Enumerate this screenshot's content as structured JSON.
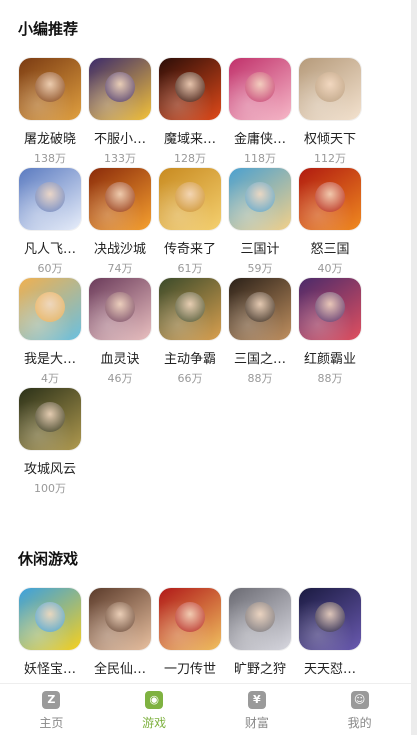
{
  "sections": [
    {
      "title": "小编推荐",
      "games": [
        {
          "name": "屠龙破晓",
          "count": "138万",
          "colors": [
            "#7a3a12",
            "#e0a040"
          ]
        },
        {
          "name": "不服小…",
          "count": "133万",
          "colors": [
            "#3b2a6b",
            "#f3c23b"
          ]
        },
        {
          "name": "魔域来…",
          "count": "128万",
          "colors": [
            "#2a0d08",
            "#e04a1a"
          ]
        },
        {
          "name": "金庸侠…",
          "count": "118万",
          "colors": [
            "#c0306a",
            "#f6b8c8"
          ]
        },
        {
          "name": "权倾天下",
          "count": "112万",
          "colors": [
            "#b59a7a",
            "#f3e2cf"
          ]
        },
        {
          "name": "凡人飞…",
          "count": "60万",
          "colors": [
            "#5a7ac0",
            "#e8eefa"
          ]
        },
        {
          "name": "决战沙城",
          "count": "74万",
          "colors": [
            "#8a2a0a",
            "#f5a030"
          ]
        },
        {
          "name": "传奇来了",
          "count": "61万",
          "colors": [
            "#c88a20",
            "#f4d070"
          ]
        },
        {
          "name": "三国计",
          "count": "59万",
          "colors": [
            "#4aa0d0",
            "#f2d08a"
          ]
        },
        {
          "name": "怒三国",
          "count": "40万",
          "colors": [
            "#b01a10",
            "#f08a20"
          ]
        },
        {
          "name": "我是大…",
          "count": "4万",
          "colors": [
            "#f0b050",
            "#6ac0e0"
          ]
        },
        {
          "name": "血灵诀",
          "count": "46万",
          "colors": [
            "#6a3a5a",
            "#e9c0c0"
          ]
        },
        {
          "name": "主动争霸",
          "count": "66万",
          "colors": [
            "#3a4a2a",
            "#d9a050"
          ]
        },
        {
          "name": "三国之…",
          "count": "88万",
          "colors": [
            "#2a2018",
            "#c09060"
          ]
        },
        {
          "name": "红颜霸业",
          "count": "88万",
          "colors": [
            "#4a2a6a",
            "#e05060"
          ]
        },
        {
          "name": "攻城风云",
          "count": "100万",
          "colors": [
            "#2a3018",
            "#b09a50"
          ]
        }
      ]
    },
    {
      "title": "休闲游戏",
      "games": [
        {
          "name": "妖怪宝…",
          "count": "",
          "colors": [
            "#3aa0e0",
            "#f6d020"
          ]
        },
        {
          "name": "全民仙…",
          "count": "",
          "colors": [
            "#5a3a2a",
            "#e8c0a0"
          ]
        },
        {
          "name": "一刀传世",
          "count": "",
          "colors": [
            "#b01818",
            "#f0c060"
          ]
        },
        {
          "name": "旷野之狩",
          "count": "",
          "colors": [
            "#6a6a72",
            "#d8d8e0"
          ]
        },
        {
          "name": "天天怼…",
          "count": "",
          "colors": [
            "#1a1a40",
            "#6a5ab0"
          ]
        }
      ]
    }
  ],
  "tabs": [
    {
      "label": "主页",
      "icon": "home-icon",
      "glyph": "Z"
    },
    {
      "label": "游戏",
      "icon": "gamepad-icon",
      "glyph": "◉"
    },
    {
      "label": "财富",
      "icon": "money-bag-icon",
      "glyph": "¥"
    },
    {
      "label": "我的",
      "icon": "user-icon",
      "glyph": "☺"
    }
  ],
  "active_tab": 1,
  "theme": {
    "accent": "#7fb241",
    "muted": "#888888"
  }
}
